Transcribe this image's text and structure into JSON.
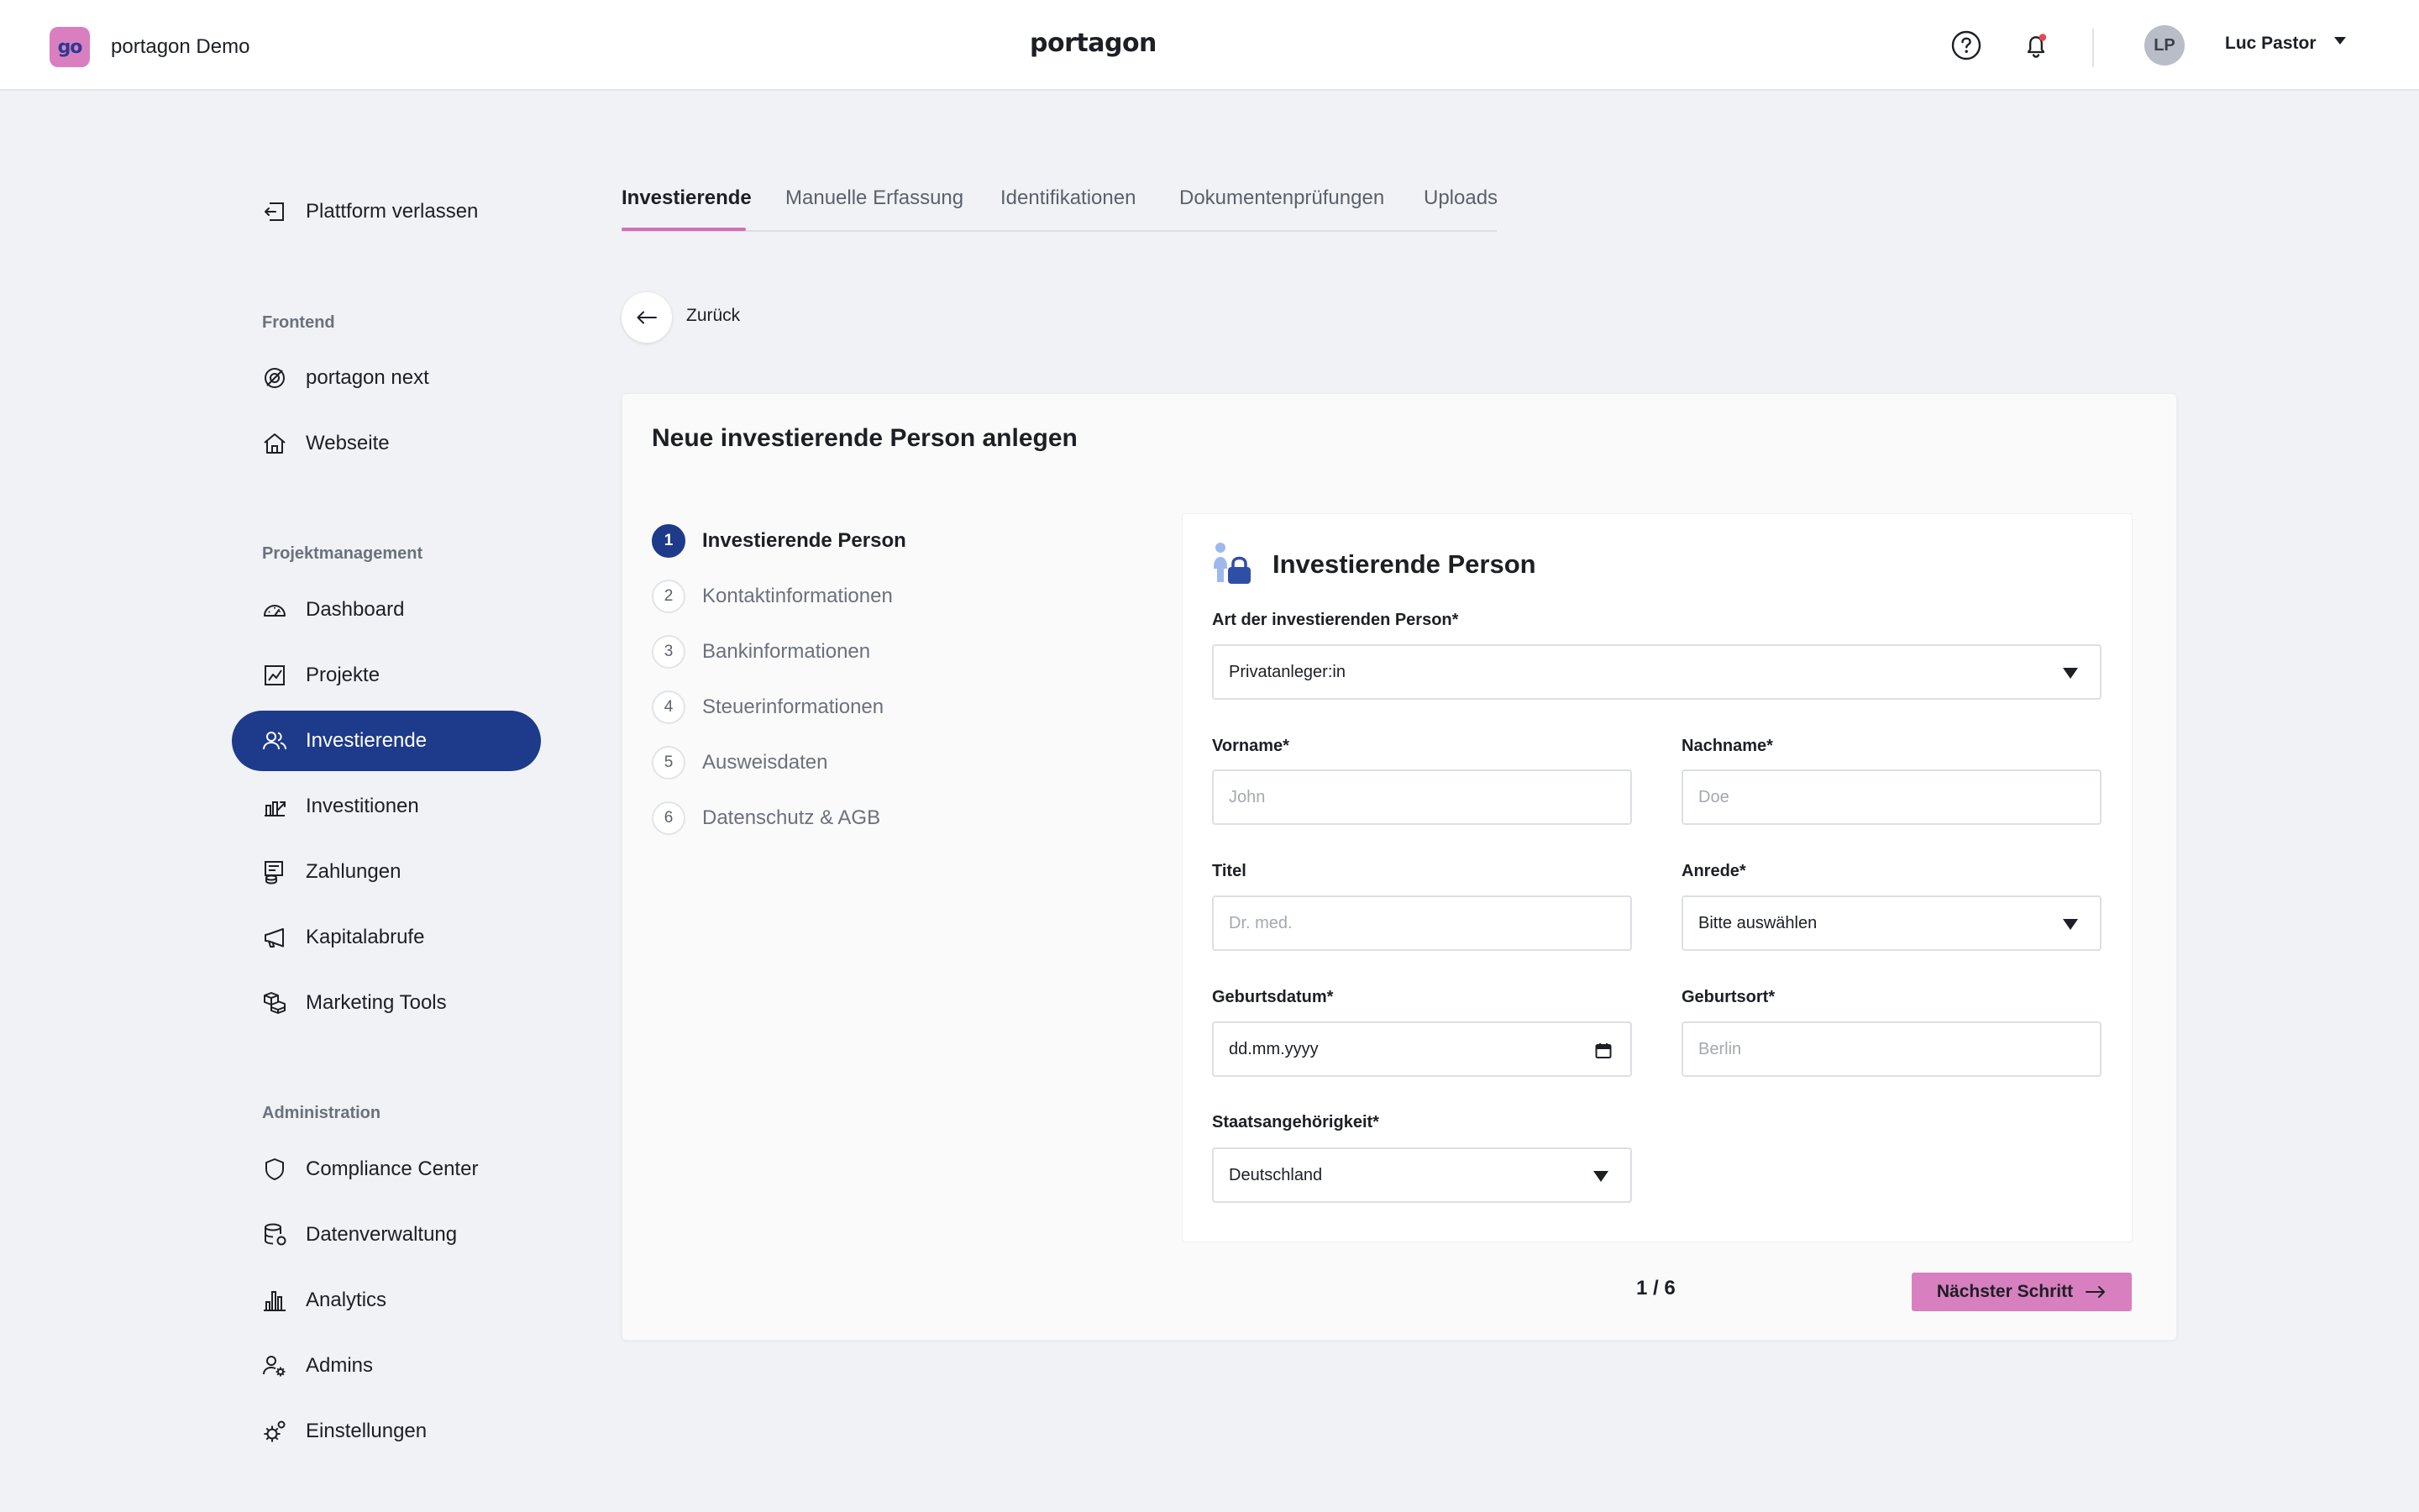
{
  "header": {
    "org_logo_text": "go",
    "org_name": "portagon Demo",
    "brand": "portagon",
    "user_initials": "LP",
    "user_name": "Luc Pastor",
    "notification_dot_color": "#e5484d"
  },
  "sidebar": {
    "exit_label": "Plattform verlassen",
    "sections": {
      "frontend": "Frontend",
      "projektmanagement": "Projektmanagement",
      "administration": "Administration"
    },
    "items": {
      "portagon_next": "portagon next",
      "webseite": "Webseite",
      "dashboard": "Dashboard",
      "projekte": "Projekte",
      "investierende": "Investierende",
      "investitionen": "Investitionen",
      "zahlungen": "Zahlungen",
      "kapitalabrufe": "Kapitalabrufe",
      "marketing_tools": "Marketing Tools",
      "compliance_center": "Compliance Center",
      "datenverwaltung": "Datenverwaltung",
      "analytics": "Analytics",
      "admins": "Admins",
      "einstellungen": "Einstellungen"
    },
    "active_item": "investierende",
    "active_color": "#1e3a8a"
  },
  "tabs": {
    "investierende": "Investierende",
    "manuelle_erfassung": "Manuelle Erfassung",
    "identifikationen": "Identifikationen",
    "dokumentenpruefungen": "Dokumentenprüfungen",
    "uploads": "Uploads",
    "active": "investierende",
    "underline_color": "#d36fb6"
  },
  "back_label": "Zurück",
  "card": {
    "title": "Neue investierende Person anlegen",
    "steps": [
      {
        "num": "1",
        "label": "Investierende Person"
      },
      {
        "num": "2",
        "label": "Kontaktinformationen"
      },
      {
        "num": "3",
        "label": "Bankinformationen"
      },
      {
        "num": "4",
        "label": "Steuerinformationen"
      },
      {
        "num": "5",
        "label": "Ausweisdaten"
      },
      {
        "num": "6",
        "label": "Datenschutz & AGB"
      }
    ],
    "current_step": 1
  },
  "form": {
    "title": "Investierende Person",
    "art_label": "Art der investierenden Person*",
    "art_value": "Privatanleger:in",
    "vorname_label": "Vorname*",
    "vorname_placeholder": "John",
    "nachname_label": "Nachname*",
    "nachname_placeholder": "Doe",
    "titel_label": "Titel",
    "titel_placeholder": "Dr. med.",
    "anrede_label": "Anrede*",
    "anrede_value": "Bitte auswählen",
    "geburtsdatum_label": "Geburtsdatum*",
    "geburtsdatum_value": "dd.mm.yyyy",
    "geburtsort_label": "Geburtsort*",
    "geburtsort_placeholder": "Berlin",
    "staatsangehoerigkeit_label": "Staatsangehörigkeit*",
    "staatsangehoerigkeit_value": "Deutschland"
  },
  "footer": {
    "pager": "1 / 6",
    "next_label": "Nächster Schritt",
    "next_color": "#d87fbf"
  }
}
